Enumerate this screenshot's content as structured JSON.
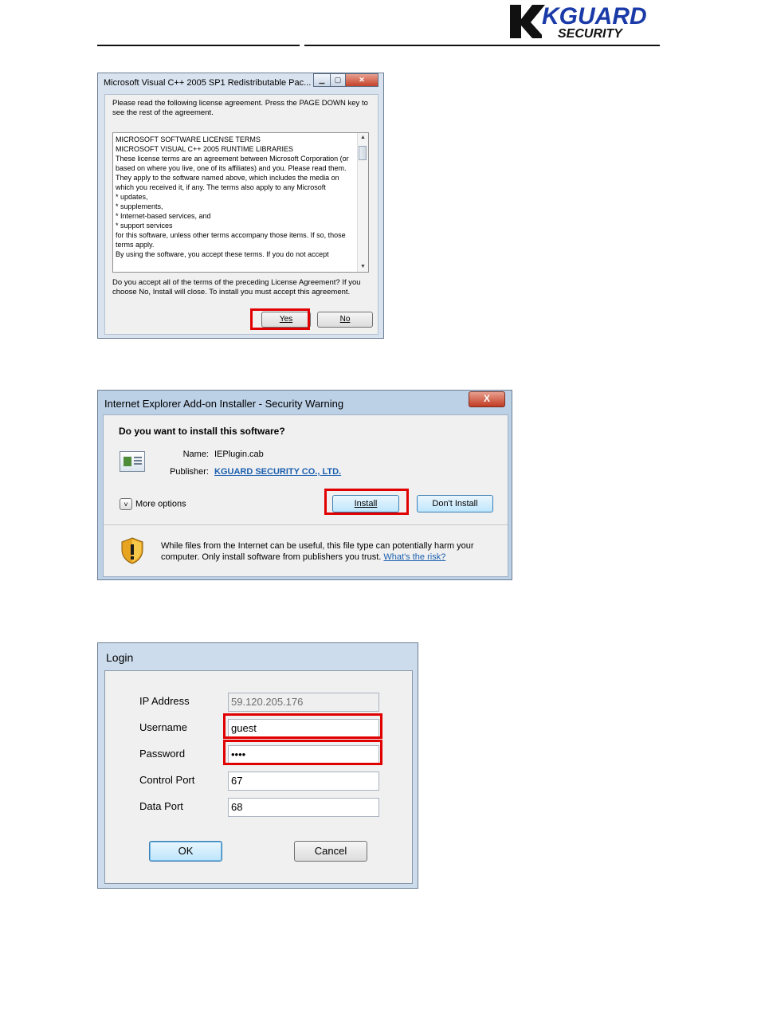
{
  "header": {
    "logo_main": "KGUARD",
    "logo_sub": "SECURITY"
  },
  "license_dialog": {
    "title": "Microsoft Visual C++ 2005 SP1 Redistributable Pac...",
    "lead": "Please read the following license agreement. Press the PAGE DOWN key to see the rest of the agreement.",
    "license_text": "MICROSOFT SOFTWARE LICENSE TERMS\nMICROSOFT VISUAL C++ 2005 RUNTIME LIBRARIES\nThese license terms are an agreement between Microsoft Corporation (or based on where you live, one of its affiliates) and you.  Please read them.  They apply to the software named above, which includes the media on which you received it, if any.  The terms also apply to any Microsoft\n* updates,\n* supplements,\n* Internet-based services, and\n* support services\nfor this software, unless other terms accompany those items.  If so, those terms apply.\nBy using the software, you accept these terms.  If you do not accept",
    "question": "Do you accept all of the terms of the preceding License Agreement? If you choose No, Install will close. To install you must accept this agreement.",
    "yes_label": "Yes",
    "no_label": "No",
    "highlight_color": "#e00000"
  },
  "security_warning": {
    "title": "Internet Explorer Add-on Installer - Security Warning",
    "close_label": "X",
    "question": "Do you want to install this software?",
    "name_label": "Name:",
    "name_value": "IEPlugin.cab",
    "publisher_label": "Publisher:",
    "publisher_value": "KGUARD SECURITY CO., LTD.",
    "more_options": "More options",
    "install_label": "Install",
    "dont_install_label": "Don't Install",
    "warning_text": "While files from the Internet can be useful, this file type can potentially harm your computer. Only install software from publishers you trust.",
    "risk_link": "What's the risk?"
  },
  "login_dialog": {
    "title": "Login",
    "fields": [
      {
        "label": "IP Address",
        "value": "59.120.205.176"
      },
      {
        "label": "Username",
        "value": "guest"
      },
      {
        "label": "Password",
        "value": "••••"
      },
      {
        "label": "Control Port",
        "value": "67"
      },
      {
        "label": "Data Port",
        "value": "68"
      }
    ],
    "ok_label": "OK",
    "cancel_label": "Cancel"
  }
}
